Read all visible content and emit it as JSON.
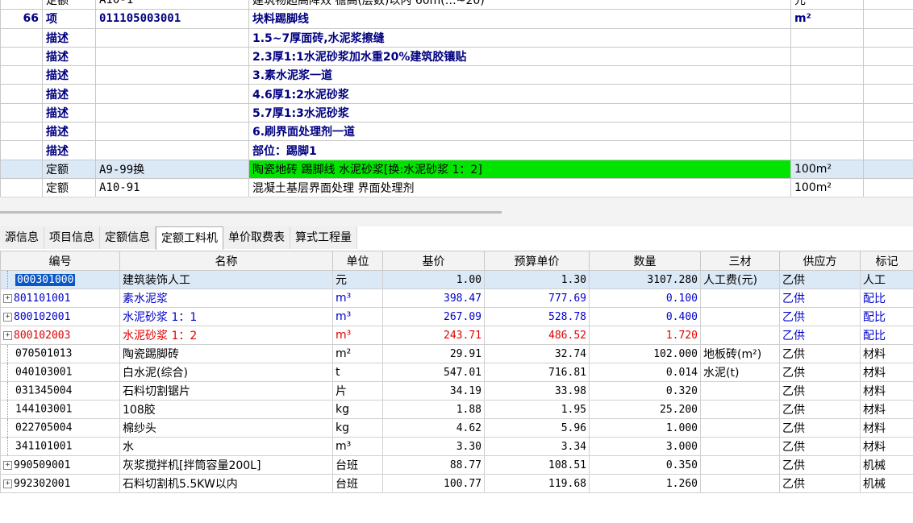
{
  "top_rows": [
    {
      "type": "quota",
      "num": "",
      "kind": "定额",
      "code": "A10-1",
      "name": "建筑物超高降效 檐高(层数)以内 60m(…~20)",
      "unit": "元"
    },
    {
      "type": "item",
      "num": "66",
      "kind": "项",
      "code": "011105003001",
      "name": "块料踢脚线",
      "unit": "m²"
    },
    {
      "type": "desc",
      "num": "",
      "kind": "描述",
      "code": "",
      "name": "1.5~7厚面砖,水泥浆擦缝",
      "unit": ""
    },
    {
      "type": "desc",
      "num": "",
      "kind": "描述",
      "code": "",
      "name": "2.3厚1:1水泥砂浆加水重20%建筑胶镶贴",
      "unit": ""
    },
    {
      "type": "desc",
      "num": "",
      "kind": "描述",
      "code": "",
      "name": "3.素水泥浆一道",
      "unit": ""
    },
    {
      "type": "desc",
      "num": "",
      "kind": "描述",
      "code": "",
      "name": "4.6厚1:2水泥砂浆",
      "unit": ""
    },
    {
      "type": "desc",
      "num": "",
      "kind": "描述",
      "code": "",
      "name": "5.7厚1:3水泥砂浆",
      "unit": ""
    },
    {
      "type": "desc",
      "num": "",
      "kind": "描述",
      "code": "",
      "name": "6.刷界面处理剂一道",
      "unit": ""
    },
    {
      "type": "desc",
      "num": "",
      "kind": "描述",
      "code": "",
      "name": "部位：踢脚1",
      "unit": ""
    },
    {
      "type": "quota-sel",
      "num": "",
      "kind": "定额",
      "code": "A9-99换",
      "name": "陶瓷地砖 踢脚线 水泥砂浆[换:水泥砂浆 1：2]",
      "unit": "100m²"
    },
    {
      "type": "quota",
      "num": "",
      "kind": "定额",
      "code": "A10-91",
      "name": "混凝土基层界面处理 界面处理剂",
      "unit": "100m²"
    }
  ],
  "tabs": [
    "源信息",
    "项目信息",
    "定额信息",
    "定额工料机",
    "单价取费表",
    "算式工程量"
  ],
  "active_tab_index": 3,
  "columns": [
    "编号",
    "名称",
    "单位",
    "基价",
    "预算单价",
    "数量",
    "三材",
    "供应方",
    "标记"
  ],
  "rows": [
    {
      "style": "sel",
      "expand": false,
      "code": "000301000",
      "name": "建筑装饰人工",
      "unit": "元",
      "base": "1.00",
      "budget": "1.30",
      "qty": "3107.280",
      "three": "人工费(元)",
      "supplier": "乙供",
      "mark": "人工"
    },
    {
      "style": "blue",
      "expand": true,
      "code": "801101001",
      "name": "素水泥浆",
      "unit": "m³",
      "base": "398.47",
      "budget": "777.69",
      "qty": "0.100",
      "three": "",
      "supplier": "乙供",
      "mark": "配比"
    },
    {
      "style": "blue",
      "expand": true,
      "code": "800102001",
      "name": "水泥砂浆 1：1",
      "unit": "m³",
      "base": "267.09",
      "budget": "528.78",
      "qty": "0.400",
      "three": "",
      "supplier": "乙供",
      "mark": "配比"
    },
    {
      "style": "red",
      "expand": true,
      "code": "800102003",
      "name": "水泥砂浆 1：2",
      "unit": "m³",
      "base": "243.71",
      "budget": "486.52",
      "qty": "1.720",
      "three": "",
      "supplier": "乙供",
      "mark": "配比"
    },
    {
      "style": "",
      "expand": false,
      "code": "070501013",
      "name": "陶瓷踢脚砖",
      "unit": "m²",
      "base": "29.91",
      "budget": "32.74",
      "qty": "102.000",
      "three": "地板砖(m²)",
      "supplier": "乙供",
      "mark": "材料"
    },
    {
      "style": "",
      "expand": false,
      "code": "040103001",
      "name": "白水泥(综合)",
      "unit": "t",
      "base": "547.01",
      "budget": "716.81",
      "qty": "0.014",
      "three": "水泥(t)",
      "supplier": "乙供",
      "mark": "材料"
    },
    {
      "style": "",
      "expand": false,
      "code": "031345004",
      "name": "石料切割锯片",
      "unit": "片",
      "base": "34.19",
      "budget": "33.98",
      "qty": "0.320",
      "three": "",
      "supplier": "乙供",
      "mark": "材料"
    },
    {
      "style": "",
      "expand": false,
      "code": "144103001",
      "name": "108胶",
      "unit": "kg",
      "base": "1.88",
      "budget": "1.95",
      "qty": "25.200",
      "three": "",
      "supplier": "乙供",
      "mark": "材料"
    },
    {
      "style": "",
      "expand": false,
      "code": "022705004",
      "name": "棉纱头",
      "unit": "kg",
      "base": "4.62",
      "budget": "5.96",
      "qty": "1.000",
      "three": "",
      "supplier": "乙供",
      "mark": "材料"
    },
    {
      "style": "",
      "expand": false,
      "code": "341101001",
      "name": "水",
      "unit": "m³",
      "base": "3.30",
      "budget": "3.34",
      "qty": "3.000",
      "three": "",
      "supplier": "乙供",
      "mark": "材料"
    },
    {
      "style": "",
      "expand": true,
      "code": "990509001",
      "name": "灰浆搅拌机[拌筒容量200L]",
      "unit": "台班",
      "base": "88.77",
      "budget": "108.51",
      "qty": "0.350",
      "three": "",
      "supplier": "乙供",
      "mark": "机械"
    },
    {
      "style": "",
      "expand": true,
      "code": "992302001",
      "name": "石料切割机5.5KW以内",
      "unit": "台班",
      "base": "100.77",
      "budget": "119.68",
      "qty": "1.260",
      "three": "",
      "supplier": "乙供",
      "mark": "机械"
    }
  ]
}
